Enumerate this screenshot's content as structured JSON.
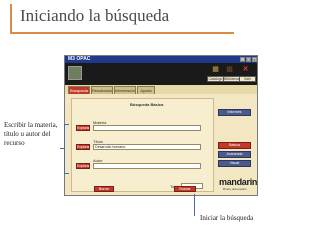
{
  "slide": {
    "title": "Iniciando la búsqueda",
    "annotation_left": "Escribir la materia, título u autor del recurso",
    "annotation_bottom": "Iniciar la búsqueda"
  },
  "app": {
    "window_title": "M3 OPAC",
    "top_buttons": [
      "Catálogo",
      "Biblioteca",
      "Salir"
    ],
    "tabs": [
      "Búsqueda",
      "Resultados",
      "Información",
      "Ayuda"
    ],
    "form": {
      "heading": "Búsqueda Básica",
      "fields": [
        {
          "label": "Materia",
          "value": "",
          "button": "Explorar"
        },
        {
          "label": "Título",
          "value": "Desarrollo humano",
          "button": "Explorar"
        },
        {
          "label": "Autor",
          "value": "",
          "button": "Explorar"
        }
      ],
      "total_label": "Total",
      "total_value": "",
      "buttons": {
        "clear": "Borrar",
        "search": "Buscar"
      }
    },
    "side_buttons": [
      "Informes",
      "Básica",
      "Avanzada",
      "Visual"
    ],
    "brand": "mandarin",
    "brand_sub": "library automation"
  },
  "colors": {
    "accent": "#c0392b",
    "titlebar": "#1f3a8a",
    "panel": "#f3e7c3",
    "frame": "#d98c4a"
  }
}
